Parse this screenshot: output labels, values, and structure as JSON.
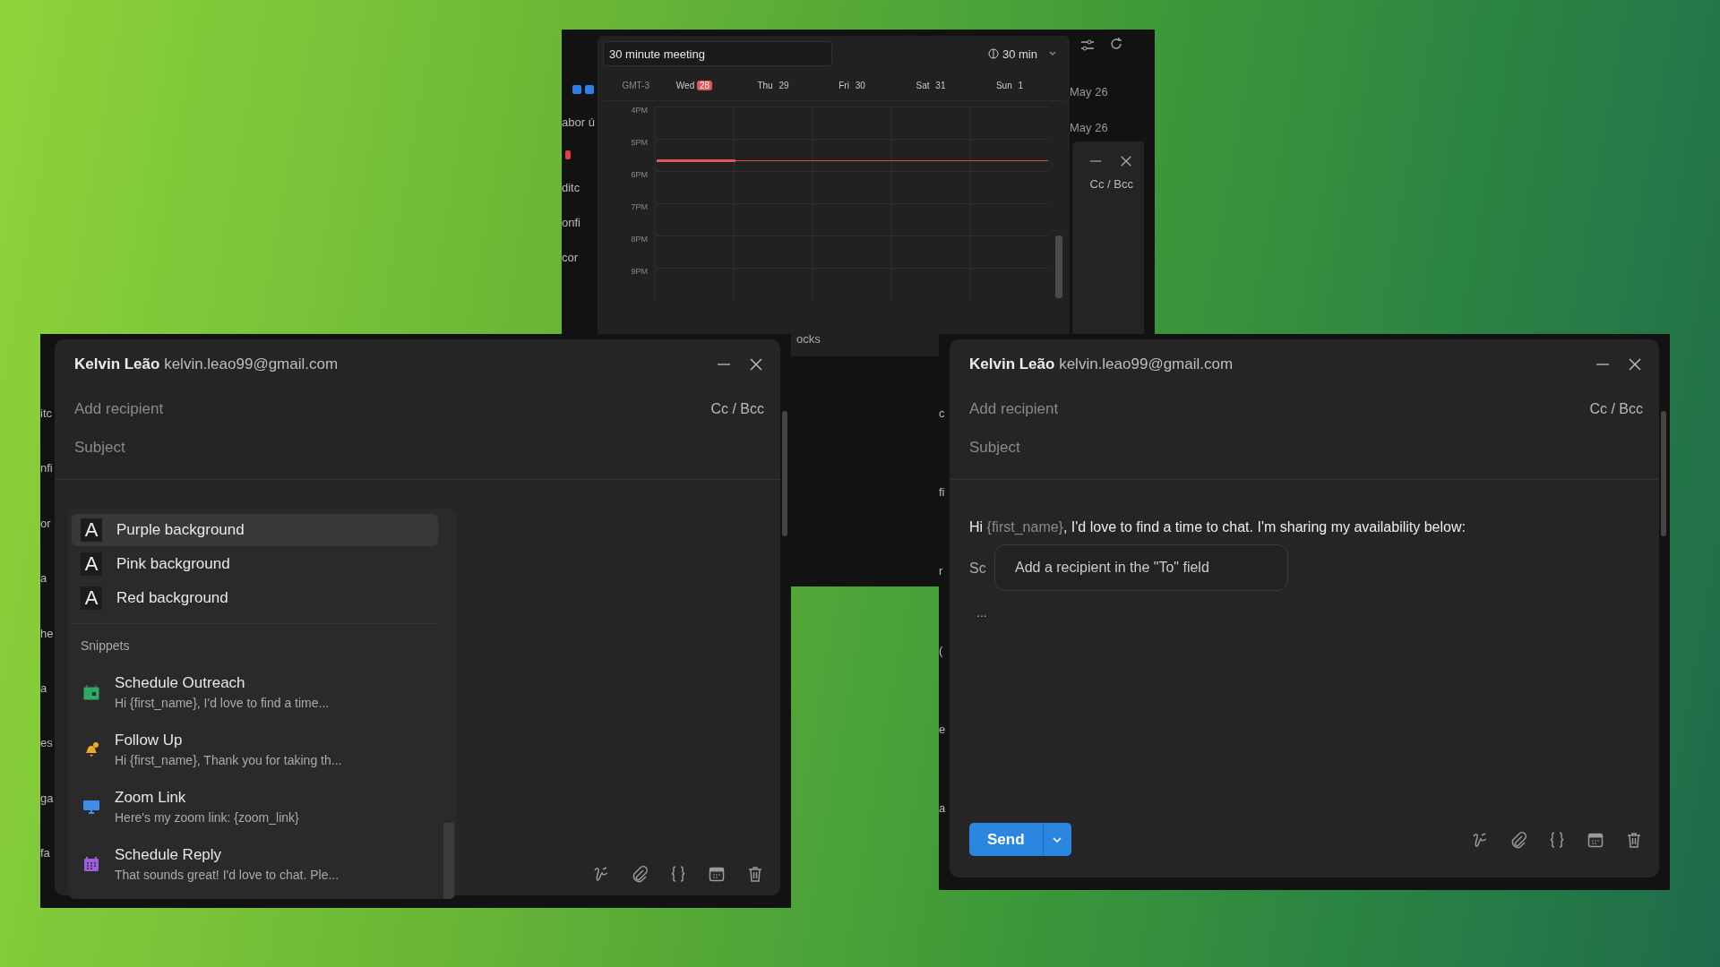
{
  "meeting_window": {
    "left_fragments": [
      "abor ú",
      "ditc",
      "onfi",
      "cor"
    ],
    "right_fragments": [
      "May 26",
      "May 26"
    ],
    "behind_compose": {
      "cc_bcc": "Cc / Bcc"
    },
    "below_text": "ocks",
    "scheduler": {
      "title": "30 minute meeting",
      "duration": "30 min",
      "timezone": "GMT-3",
      "days": [
        {
          "name": "Wed",
          "date": "28",
          "today": true
        },
        {
          "name": "Thu",
          "date": "29",
          "today": false
        },
        {
          "name": "Fri",
          "date": "30",
          "today": false
        },
        {
          "name": "Sat",
          "date": "31",
          "today": false
        },
        {
          "name": "Sun",
          "date": "1",
          "today": false
        }
      ],
      "hours": [
        "4PM",
        "5PM",
        "6PM",
        "7PM",
        "8PM",
        "9PM"
      ]
    }
  },
  "compose_left": {
    "left_fragments": [
      "itc",
      "nfi",
      "or",
      "a",
      "he",
      "a",
      "es",
      "ga",
      "fa"
    ],
    "sender_name": "Kelvin Leão",
    "sender_email": "kelvin.leao99@gmail.com",
    "recipient_placeholder": "Add recipient",
    "cc_bcc": "Cc / Bcc",
    "subject_placeholder": "Subject",
    "menu": {
      "formats": [
        {
          "label": "Purple background",
          "glyph": "A",
          "selected": true
        },
        {
          "label": "Pink background",
          "glyph": "A",
          "selected": false
        },
        {
          "label": "Red background",
          "glyph": "A",
          "selected": false
        }
      ],
      "section": "Snippets",
      "snippets": [
        {
          "title": "Schedule Outreach",
          "preview": "Hi {first_name}, I'd love to find a time...",
          "kind": "calendar-plus",
          "color": "#2fa866"
        },
        {
          "title": "Follow Up",
          "preview": "Hi {first_name}, Thank you for taking th...",
          "kind": "bell",
          "color": "#f0a626"
        },
        {
          "title": "Zoom Link",
          "preview": "Here's my zoom link: {zoom_link}",
          "kind": "monitor",
          "color": "#3d8ee8"
        },
        {
          "title": "Schedule Reply",
          "preview": "That sounds great! I'd love to chat. Ple...",
          "kind": "calendar-grid",
          "color": "#9d5fe0"
        }
      ]
    }
  },
  "compose_right": {
    "left_fragments": [
      "c",
      "fi",
      "r",
      "(",
      "e",
      "a"
    ],
    "sender_name": "Kelvin Leão",
    "sender_email": "kelvin.leao99@gmail.com",
    "recipient_placeholder": "Add recipient",
    "cc_bcc": "Cc / Bcc",
    "subject_placeholder": "Subject",
    "body": [
      {
        "text": "Hi ",
        "kind": "text"
      },
      {
        "text": "{first_name}",
        "kind": "variable"
      },
      {
        "text": ", I'd love to find a time to chat. I'm sharing my availability below:",
        "kind": "text"
      }
    ],
    "hidden_line": "Sc",
    "tooltip": "Add a recipient in the \"To\" field",
    "ellipsis": "...",
    "send_label": "Send"
  }
}
